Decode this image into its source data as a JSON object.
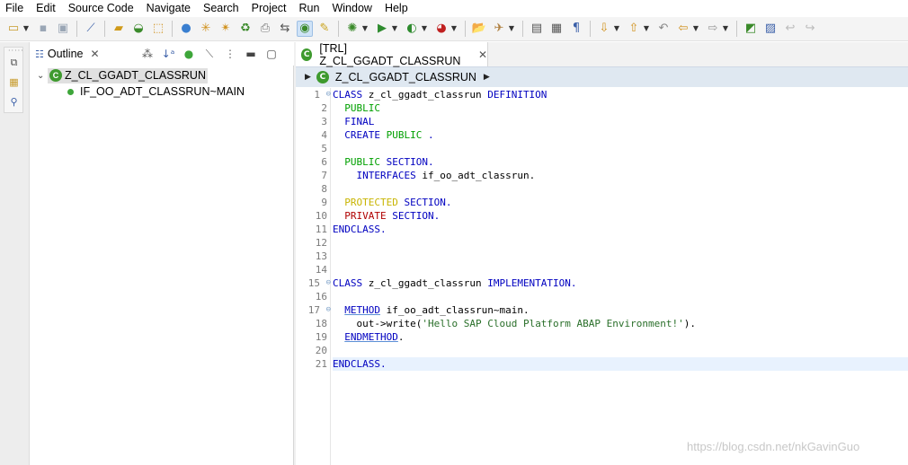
{
  "menubar": {
    "items": [
      "File",
      "Edit",
      "Source Code",
      "Navigate",
      "Search",
      "Project",
      "Run",
      "Window",
      "Help"
    ]
  },
  "toolbar": {
    "icons": [
      "new-icon",
      "save-icon",
      "save-all-icon",
      "link-icon",
      "open-type-icon",
      "package-icon",
      "check-icon",
      "activate-icon",
      "bug-icon",
      "refresh-icon",
      "print-icon",
      "transport-icon",
      "pretty-printer-icon",
      "highlight-icon",
      "debug-icon",
      "run-icon",
      "coverage-icon",
      "external-tools-icon",
      "open-folder-icon",
      "pin-icon",
      "task-icon",
      "pilcrow-icon",
      "next-annotation-icon",
      "previous-annotation-icon",
      "last-edit-icon",
      "back-icon",
      "forward-icon",
      "new-window-icon",
      "image-icon",
      "undo-icon",
      "redo-icon"
    ]
  },
  "outline": {
    "title": "Outline",
    "close_glyph": "✕",
    "root_label": "Z_CL_GGADT_CLASSRUN",
    "root_icon_letter": "C",
    "child_label": "IF_OO_ADT_CLASSRUN~MAIN"
  },
  "editor": {
    "tab_label": "[TRL] Z_CL_GGADT_CLASSRUN",
    "close_glyph": "✕",
    "breadcrumb_label": "Z_CL_GGADT_CLASSRUN",
    "current_line": 21,
    "fold_lines": [
      1,
      15,
      17
    ],
    "line_numbers": [
      "1",
      "2",
      "3",
      "4",
      "5",
      "6",
      "7",
      "8",
      "9",
      "10",
      "11",
      "12",
      "13",
      "14",
      "15",
      "16",
      "17",
      "18",
      "19",
      "20",
      "21"
    ],
    "lines": [
      [
        {
          "t": "CLASS",
          "c": "kw"
        },
        {
          "t": " z_cl_ggadt_classrun ",
          "c": "plain"
        },
        {
          "t": "DEFINITION",
          "c": "kw"
        }
      ],
      [
        {
          "t": "  ",
          "c": "plain"
        },
        {
          "t": "PUBLIC",
          "c": "kwg"
        }
      ],
      [
        {
          "t": "  ",
          "c": "plain"
        },
        {
          "t": "FINAL",
          "c": "kw"
        }
      ],
      [
        {
          "t": "  ",
          "c": "plain"
        },
        {
          "t": "CREATE",
          "c": "kw"
        },
        {
          "t": " ",
          "c": "plain"
        },
        {
          "t": "PUBLIC",
          "c": "kwg"
        },
        {
          "t": " .",
          "c": "kw"
        }
      ],
      [],
      [
        {
          "t": "  ",
          "c": "plain"
        },
        {
          "t": "PUBLIC",
          "c": "kwg"
        },
        {
          "t": " SECTION.",
          "c": "kw"
        }
      ],
      [
        {
          "t": "    ",
          "c": "plain"
        },
        {
          "t": "INTERFACES",
          "c": "kw"
        },
        {
          "t": " if_oo_adt_classrun.",
          "c": "plain"
        }
      ],
      [],
      [
        {
          "t": "  ",
          "c": "plain"
        },
        {
          "t": "PROTECTED",
          "c": "kwy"
        },
        {
          "t": " SECTION.",
          "c": "kw"
        }
      ],
      [
        {
          "t": "  ",
          "c": "plain"
        },
        {
          "t": "PRIVATE",
          "c": "kwr"
        },
        {
          "t": " SECTION.",
          "c": "kw"
        }
      ],
      [
        {
          "t": "ENDCLASS.",
          "c": "kw"
        }
      ],
      [],
      [],
      [],
      [
        {
          "t": "CLASS",
          "c": "kw"
        },
        {
          "t": " z_cl_ggadt_classrun ",
          "c": "plain"
        },
        {
          "t": "IMPLEMENTATION.",
          "c": "kw"
        }
      ],
      [],
      [
        {
          "t": "  ",
          "c": "plain"
        },
        {
          "t": "METHOD",
          "c": "kwu"
        },
        {
          "t": " if_oo_adt_classrun~main.",
          "c": "plain"
        }
      ],
      [
        {
          "t": "    out->",
          "c": "plain"
        },
        {
          "t": "write(",
          "c": "plain"
        },
        {
          "t": "'Hello SAP Cloud Platform ABAP Environment!'",
          "c": "str"
        },
        {
          "t": ").",
          "c": "plain"
        }
      ],
      [
        {
          "t": "  ",
          "c": "plain"
        },
        {
          "t": "ENDMETHOD",
          "c": "kwu"
        },
        {
          "t": ".",
          "c": "plain"
        }
      ],
      [],
      [
        {
          "t": "ENDCLASS.",
          "c": "kw"
        }
      ]
    ]
  },
  "watermark": "https://blog.csdn.net/nkGavinGuo"
}
